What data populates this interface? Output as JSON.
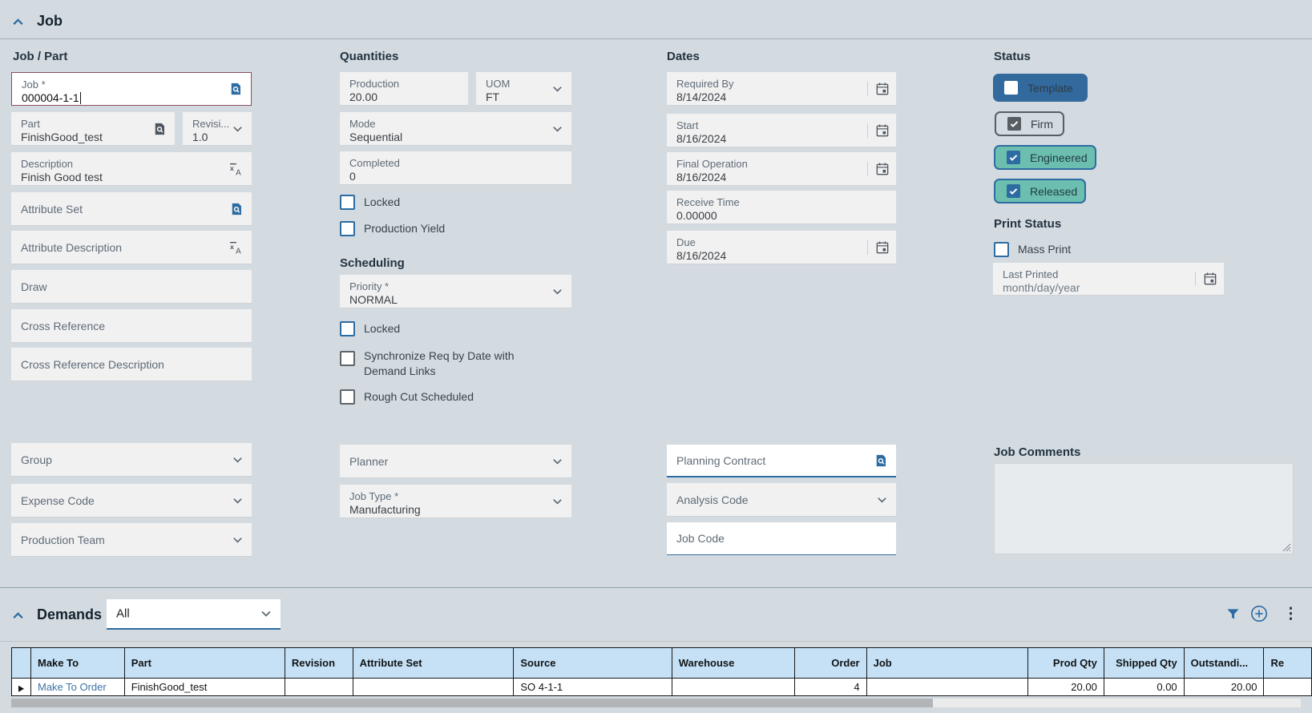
{
  "colors": {
    "pageBg": "#d3dbe1",
    "accent": "#2d6ca2",
    "focusBorder": "#8b4d62",
    "templateBlue": "#336a9e",
    "statusTeal": "#6cbfae",
    "tableHeaderBlue": "#c6e1f5",
    "linkBlue": "#3d74a6"
  },
  "jobSection": {
    "title": "Job",
    "jobPart": {
      "heading": "Job / Part",
      "job": {
        "label": "Job *",
        "value": "000004-1-1"
      },
      "part": {
        "label": "Part",
        "value": "FinishGood_test"
      },
      "revision": {
        "label": "Revisi...",
        "value": "1.0"
      },
      "description": {
        "label": "Description",
        "value": "Finish Good test"
      },
      "attributeSet": {
        "label": "Attribute Set"
      },
      "attributeDescription": {
        "label": "Attribute Description"
      },
      "draw": {
        "label": "Draw"
      },
      "crossReference": {
        "label": "Cross Reference"
      },
      "crossReferenceDescription": {
        "label": "Cross Reference Description"
      },
      "group": {
        "label": "Group"
      },
      "expenseCode": {
        "label": "Expense Code"
      },
      "productionTeam": {
        "label": "Production Team"
      }
    },
    "quantities": {
      "heading": "Quantities",
      "production": {
        "label": "Production",
        "value": "20.00"
      },
      "uom": {
        "label": "UOM",
        "value": "FT"
      },
      "mode": {
        "label": "Mode",
        "value": "Sequential"
      },
      "completed": {
        "label": "Completed",
        "value": "0"
      },
      "locked": {
        "label": "Locked",
        "checked": false
      },
      "productionYield": {
        "label": "Production Yield",
        "checked": false
      }
    },
    "scheduling": {
      "heading": "Scheduling",
      "priority": {
        "label": "Priority *",
        "value": "NORMAL"
      },
      "locked": {
        "label": "Locked",
        "checked": false
      },
      "syncReq": {
        "label": "Synchronize Req by Date with Demand Links",
        "checked": false
      },
      "roughCut": {
        "label": "Rough Cut Scheduled",
        "checked": false
      },
      "planner": {
        "label": "Planner"
      },
      "jobType": {
        "label": "Job Type *",
        "value": "Manufacturing"
      }
    },
    "dates": {
      "heading": "Dates",
      "requiredBy": {
        "label": "Required By",
        "value": "8/14/2024"
      },
      "start": {
        "label": "Start",
        "value": "8/16/2024"
      },
      "finalOperation": {
        "label": "Final Operation",
        "value": "8/16/2024"
      },
      "receiveTime": {
        "label": "Receive Time",
        "value": "0.00000"
      },
      "due": {
        "label": "Due",
        "value": "8/16/2024"
      },
      "planningContract": {
        "label": "Planning Contract"
      },
      "analysisCode": {
        "label": "Analysis Code"
      },
      "jobCode": {
        "label": "Job Code"
      }
    },
    "status": {
      "heading": "Status",
      "template": {
        "label": "Template",
        "checked": false
      },
      "firm": {
        "label": "Firm",
        "checked": true
      },
      "engineered": {
        "label": "Engineered",
        "checked": true
      },
      "released": {
        "label": "Released",
        "checked": true
      },
      "printStatus": "Print Status",
      "massPrint": {
        "label": "Mass Print",
        "checked": false
      },
      "lastPrinted": {
        "label": "Last Printed",
        "placeholder": "month/day/year"
      },
      "jobComments": {
        "label": "Job Comments"
      }
    }
  },
  "demands": {
    "title": "Demands",
    "filterValue": "All",
    "columns": [
      "",
      "Make To",
      "Part",
      "Revision",
      "Attribute Set",
      "Source",
      "Warehouse",
      "Order",
      "Job",
      "Prod Qty",
      "Shipped Qty",
      "Outstandi...",
      "Re"
    ],
    "row": [
      "Make To Order",
      "FinishGood_test",
      "",
      "",
      "SO 4-1-1",
      "",
      "4",
      "",
      "20.00",
      "0.00",
      "20.00",
      ""
    ]
  }
}
